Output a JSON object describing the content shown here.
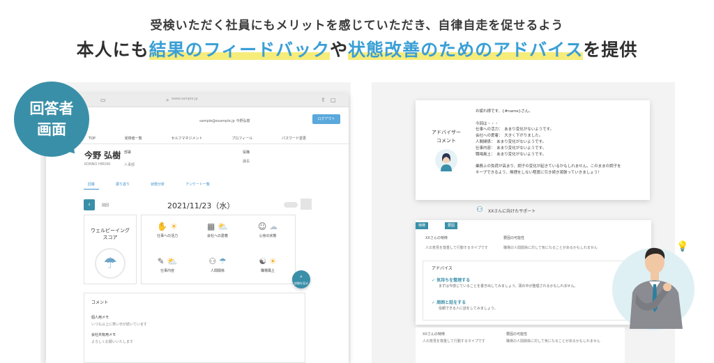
{
  "headline": {
    "line1": "受検いただく社員にもメリットを感じていただき、自律自走を促せるよう",
    "line2_pre": "本人にも",
    "line2_hl1": "結果のフィードバック",
    "line2_mid": "や",
    "line2_hl2": "状態改善のためのアドバイス",
    "line2_post": "を提供"
  },
  "bubble": {
    "line1": "回答者",
    "line2": "画面"
  },
  "browser": {
    "url": "www.sample.jp",
    "user_email": "sample@example.jp 今野弘樹",
    "logout": "ログアウト",
    "nav": [
      "TOP",
      "受検者一覧",
      "セルフマネジメント",
      "プロフィール",
      "パスワード変更"
    ],
    "user_name": "今野 弘樹",
    "user_sub": "KONNO HIROKI",
    "dept_label": "部署",
    "dept_value": "人事部",
    "title_label": "役職",
    "title_value": "課長",
    "tabs": [
      "回答",
      "振り返り",
      "状態分析",
      "アンケート一覧"
    ],
    "prev_label": "前回",
    "date": "2021/11/23（水）",
    "wellbeing_line1": "ウェルビーイング",
    "wellbeing_line2": "スコア",
    "cells": [
      "仕事への活力",
      "会社への愛着",
      "心身の状態",
      "仕事内容",
      "人間関係",
      "職場風土"
    ],
    "fab": "詳細を見る",
    "comment_title": "コメント",
    "comment_items": [
      {
        "label": "個人用メモ",
        "text": "いつも以上に寒い日が続いています"
      },
      {
        "label": "会社共有用メモ",
        "text": "よろしくお願いいたします"
      }
    ]
  },
  "advisor_card": {
    "label_line1": "アドバイザー",
    "label_line2": "コメント",
    "message": "お疲れ様です、{#name}さん。\n\n今回は・・・\n仕事への活力：　あまり変化がないようです。\n会社への愛着：　大きく下がりました。\n人間関係：　あまり変化がないようです。\n仕事内容：　あまり変化がないようです。\n職場風土：　あまり変化がないようです。\n\n業務上の負荷が高まり、調子の変化が起きているかもしれません。このままの調子を\nキープできるよう、無理をしない程度に引き続き頑張っていきましょう！"
  },
  "support_title": "XXさんに向けたサポート",
  "pa_card": {
    "tag1": "特徴",
    "tag2": "要因",
    "left_title": "XXさんの特徴",
    "left_text": "人の意見を尊重して行動するタイプです",
    "right_title": "要因の可能性",
    "right_text": "職場の人間関係に対して気になることがあるかもしれません",
    "advice_title": "アドバイス",
    "points": [
      {
        "title": "気持ちを整理する",
        "text": "まずは今感じていることを書き出してみましょう。頭の中が整理されるかもしれません。"
      },
      {
        "title": "周囲と話をする",
        "text": "信頼できる人に話をしてみましょう。"
      }
    ]
  },
  "bottom_card": {
    "left_title": "XXさんの特徴",
    "left_text": "人の意見を尊重して行動するタイプです",
    "right_title": "要因の可能性",
    "right_text": "職場の人間関係に対して気になることがあるかもしれません"
  },
  "colors": {
    "accent": "#3a8fa8",
    "highlight_text": "#3a9fd5",
    "highlight_marker": "#f6ec7a"
  }
}
